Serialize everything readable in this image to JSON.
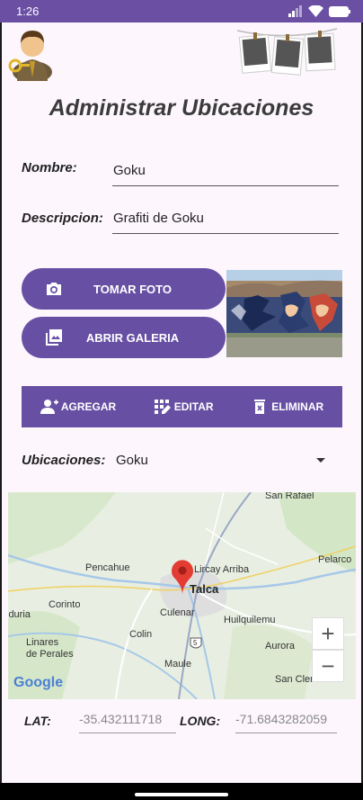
{
  "status_bar": {
    "time": "1:26"
  },
  "page": {
    "title": "Administrar Ubicaciones"
  },
  "form": {
    "nombre_label": "Nombre:",
    "nombre_value": "Goku",
    "descripcion_label": "Descripcion:",
    "descripcion_value": "Grafiti de Goku"
  },
  "buttons": {
    "tomar_foto": "TOMAR FOTO",
    "abrir_galeria": "ABRIR GALERIA"
  },
  "actions": {
    "agregar": "AGREGAR",
    "editar": "EDITAR",
    "eliminar": "ELIMINAR"
  },
  "ubicaciones": {
    "label": "Ubicaciones:",
    "selected": "Goku"
  },
  "map": {
    "labels": {
      "san_rafael": "San Rafael",
      "pencahue": "Pencahue",
      "lircay_arriba": "Lircay Arriba",
      "pelarco": "Pelarco",
      "talca": "Talca",
      "corinto": "Corinto",
      "culenar": "Culenar",
      "huilquilemu": "Huilquilemu",
      "iduria": "iduria",
      "colin": "Colin",
      "linares_de_perales": "Linares\nde Perales",
      "aurora": "Aurora",
      "maule": "Maule",
      "san_clemente": "San Clemente",
      "route": "5"
    },
    "zoom_in": "+",
    "zoom_out": "−",
    "attribution": "Google"
  },
  "coords": {
    "lat_label": "LAT:",
    "lat_value": "-35.432111718",
    "long_label": "LONG:",
    "long_value": "-71.6843282059"
  },
  "colors": {
    "accent": "#6750a4",
    "status_bar": "#6a4fa3"
  }
}
